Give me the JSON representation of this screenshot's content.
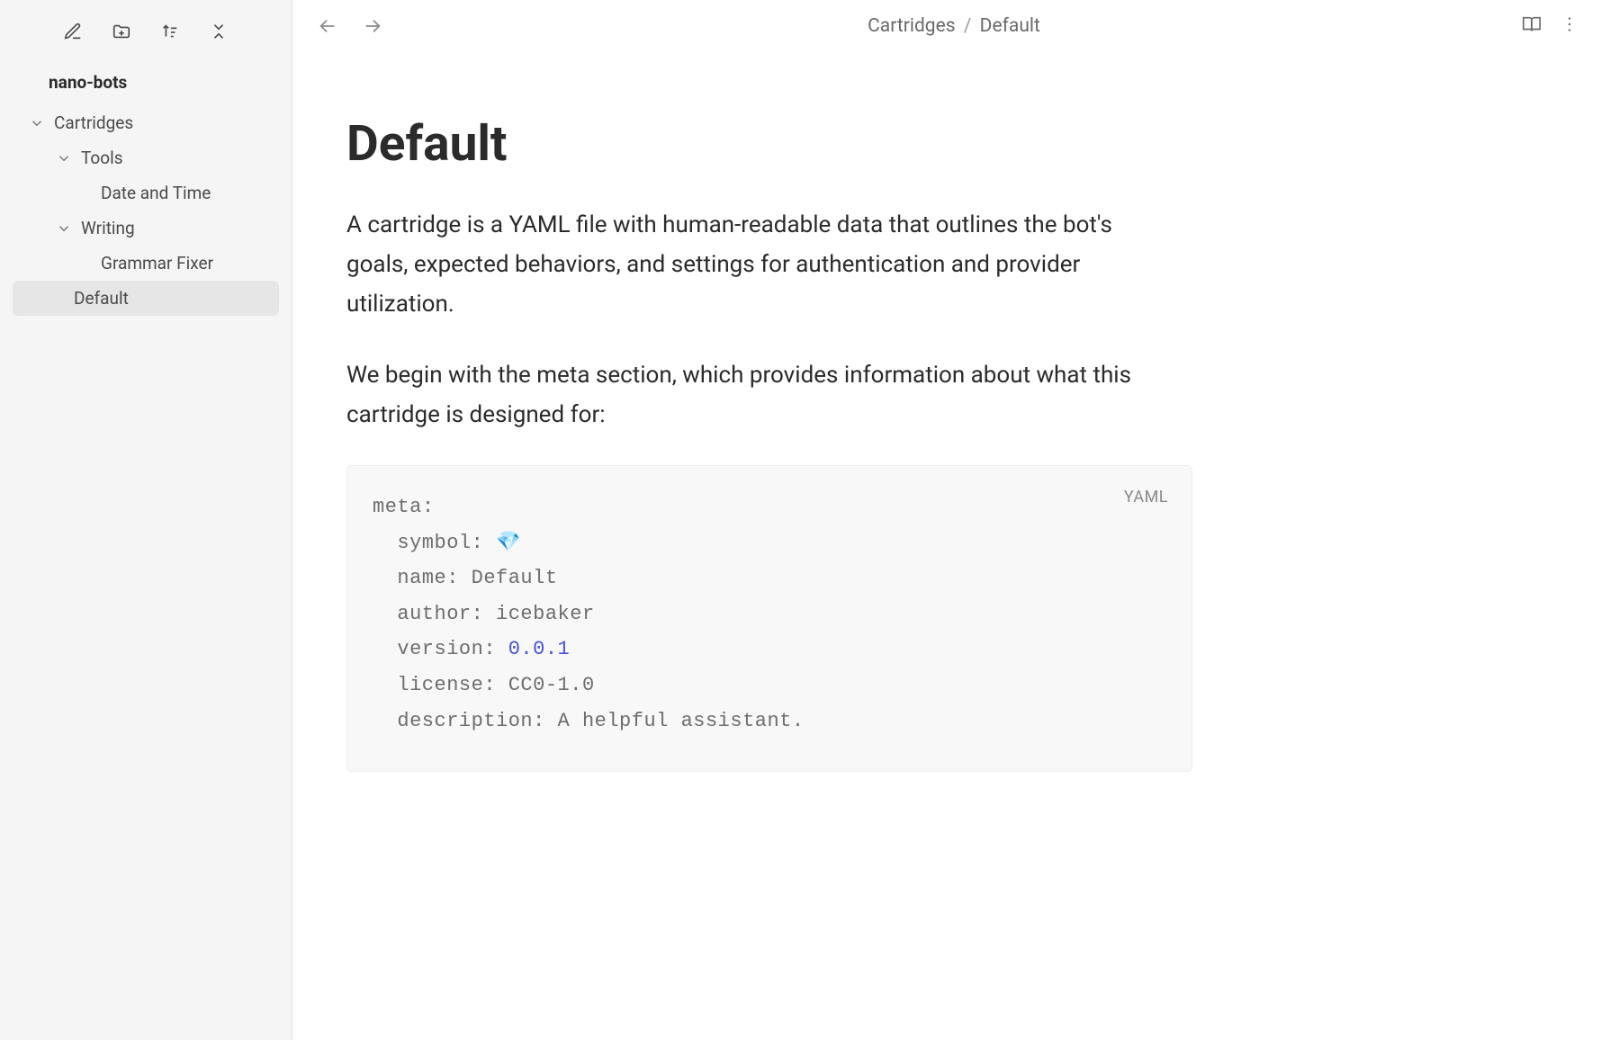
{
  "sidebar": {
    "title": "nano-bots",
    "tree": {
      "level0": {
        "label": "Cartridges"
      },
      "tools": {
        "label": "Tools"
      },
      "datetime": {
        "label": "Date and Time"
      },
      "writing": {
        "label": "Writing"
      },
      "grammar": {
        "label": "Grammar Fixer"
      },
      "default_item": {
        "label": "Default"
      }
    }
  },
  "header": {
    "breadcrumb_parent": "Cartridges",
    "breadcrumb_sep": "/",
    "breadcrumb_current": "Default"
  },
  "doc": {
    "title": "Default",
    "para1": "A cartridge is a YAML file with human-readable data that outlines the bot's goals, expected behaviors, and settings for authentication and provider utilization.",
    "para2": "We begin with the meta section, which provides information about what this cartridge is designed for:"
  },
  "code": {
    "lang": "YAML",
    "meta_key": "meta",
    "symbol_key": "symbol",
    "symbol_value": "💎",
    "name_key": "name",
    "name_value": "Default",
    "author_key": "author",
    "author_value": "icebaker",
    "version_key": "version",
    "version_value": "0.0.1",
    "license_key": "license",
    "license_value": "CC0-1.0",
    "description_key": "description",
    "description_value": "A helpful assistant."
  }
}
